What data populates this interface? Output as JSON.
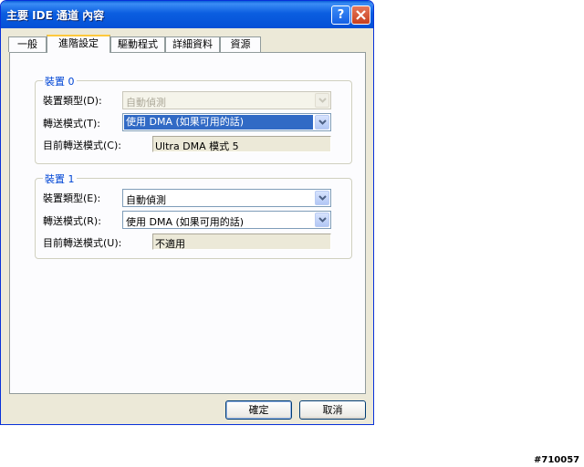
{
  "window": {
    "title": "主要 IDE 通道 內容"
  },
  "tabs": [
    {
      "label": "一般"
    },
    {
      "label": "進階設定"
    },
    {
      "label": "驅動程式"
    },
    {
      "label": "詳細資料"
    },
    {
      "label": "資源"
    }
  ],
  "device0": {
    "group_label": "裝置 0",
    "device_type_label": "裝置類型(D):",
    "device_type_value": "自動偵測",
    "transfer_mode_label": "轉送模式(T):",
    "transfer_mode_value": "使用 DMA (如果可用的話)",
    "current_mode_label": "目前轉送模式(C):",
    "current_mode_value": "Ultra DMA 模式 5"
  },
  "device1": {
    "group_label": "裝置 1",
    "device_type_label": "裝置類型(E):",
    "device_type_value": "自動偵測",
    "transfer_mode_label": "轉送模式(R):",
    "transfer_mode_value": "使用 DMA (如果可用的話)",
    "current_mode_label": "目前轉送模式(U):",
    "current_mode_value": "不適用"
  },
  "buttons": {
    "ok": "確定",
    "cancel": "取消"
  },
  "watermark": "#710057",
  "colors": {
    "titlebar": "#0450d6",
    "group_label": "#0046d5",
    "selection": "#316ac5",
    "close": "#c8401f"
  }
}
